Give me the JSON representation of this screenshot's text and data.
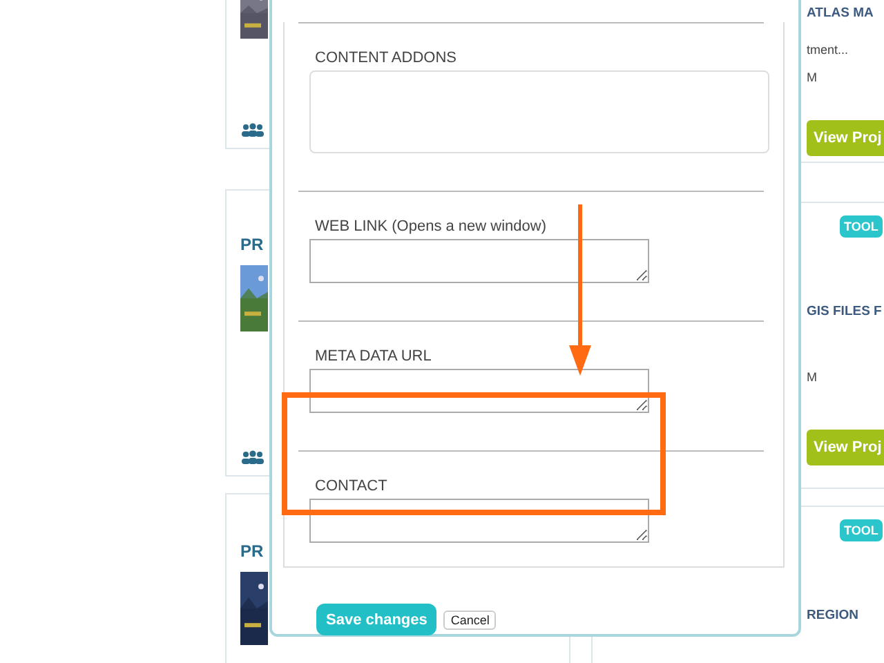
{
  "background": {
    "left_cards": [
      {
        "picture": true,
        "members_icon": true
      },
      {
        "title": "PR",
        "picture": true,
        "members_icon": true
      },
      {
        "title": "PR",
        "picture": true,
        "members_icon": false
      }
    ],
    "right_cards": [
      {
        "title": "ATLAS MA",
        "lines": [
          "tment...",
          "M"
        ],
        "button": "View Proj"
      },
      {
        "badge": "TOOL",
        "title": "GIS FILES F",
        "lines": [
          "M"
        ],
        "button": "View Proj"
      },
      {
        "badge": "TOOL",
        "title": "REGION"
      }
    ]
  },
  "modal": {
    "sections": [
      {
        "label": "CONTENT ADDONS",
        "kind": "wide"
      },
      {
        "label": "WEB LINK (Opens a new window)",
        "kind": "small"
      },
      {
        "label": "META DATA URL",
        "kind": "small"
      },
      {
        "label": "CONTACT",
        "kind": "small",
        "highlighted": true
      }
    ],
    "buttons": [
      {
        "label": "Save changes",
        "kind": "primary"
      },
      {
        "label": "Cancel",
        "kind": "plain"
      }
    ]
  },
  "annotation": {
    "arrow": true
  }
}
